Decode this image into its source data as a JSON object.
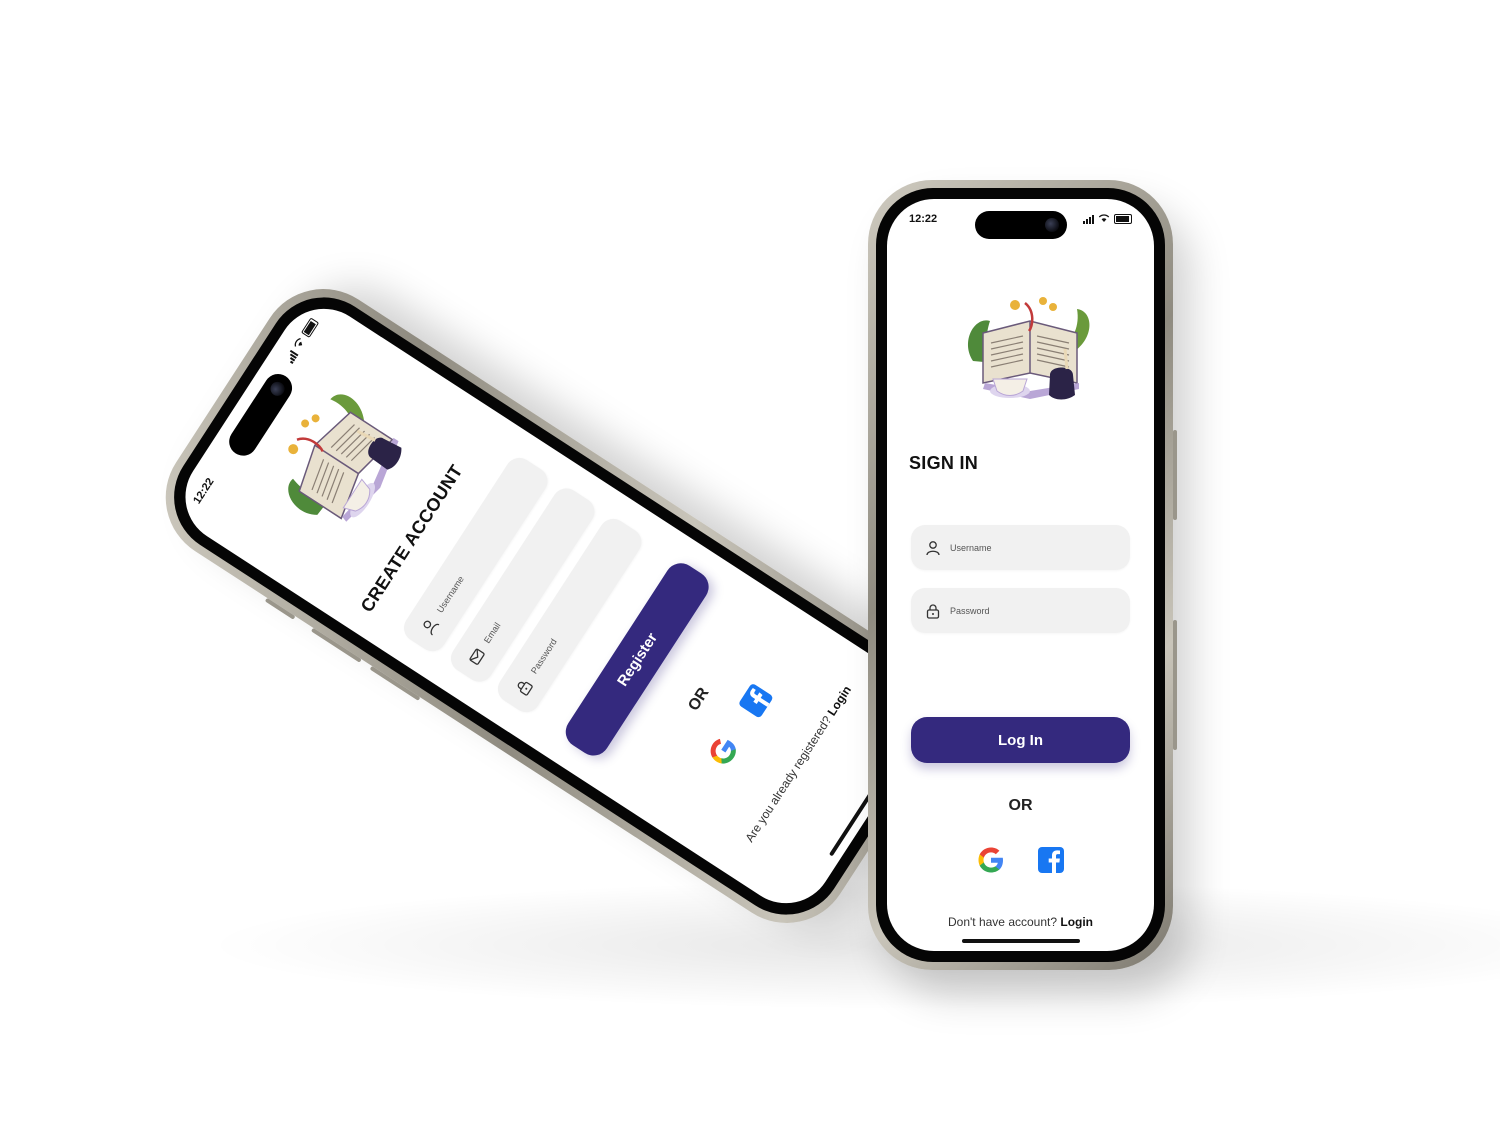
{
  "status_bar": {
    "time": "12:22"
  },
  "create_account_screen": {
    "title": "CREATE ACCOUNT",
    "username_placeholder": "Username",
    "email_placeholder": "Email",
    "password_placeholder": "Password",
    "register_label": "Register",
    "or_label": "OR",
    "footer_prefix": "Are you already registered?",
    "footer_link": "Login"
  },
  "sign_in_screen": {
    "title": "SIGN IN",
    "username_placeholder": "Username",
    "password_placeholder": "Password",
    "login_label": "Log In",
    "or_label": "OR",
    "footer_prefix": "Don't have account?",
    "footer_link": "Login"
  },
  "colors": {
    "primary": "#34297e",
    "field_bg": "#f1f1f1",
    "google_blue": "#4285F4",
    "google_red": "#EA4335",
    "google_yellow": "#FBBC05",
    "google_green": "#34A853",
    "facebook_blue": "#1877F2"
  },
  "icons": [
    "user-icon",
    "mail-icon",
    "lock-icon",
    "google-icon",
    "facebook-icon",
    "book-illustration"
  ]
}
